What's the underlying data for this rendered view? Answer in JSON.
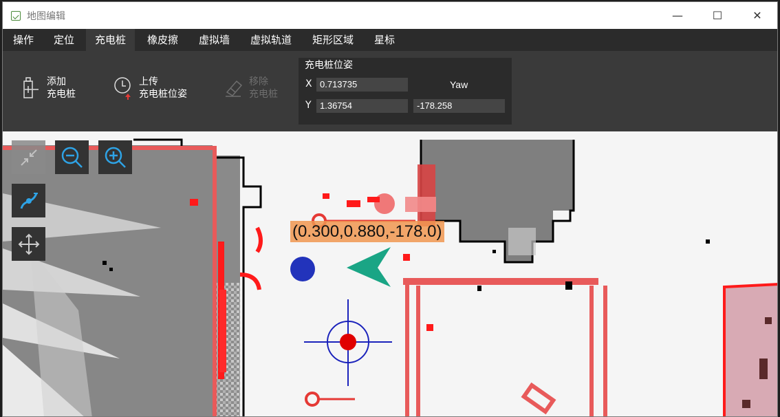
{
  "window": {
    "title": "地图编辑",
    "minimize": "—",
    "maximize": "☐",
    "close": "✕"
  },
  "menu": [
    {
      "label": "操作",
      "active": false
    },
    {
      "label": "定位",
      "active": false
    },
    {
      "label": "充电桩",
      "active": true
    },
    {
      "label": "橡皮擦",
      "active": false
    },
    {
      "label": "虚拟墙",
      "active": false
    },
    {
      "label": "虚拟轨道",
      "active": false
    },
    {
      "label": "矩形区域",
      "active": false
    },
    {
      "label": "星标",
      "active": false
    }
  ],
  "toolbar": {
    "add_line1": "添加",
    "add_line2": "充电桩",
    "upload_line1": "上传",
    "upload_line2": "充电桩位姿",
    "remove_line1": "移除",
    "remove_line2": "充电桩"
  },
  "pose": {
    "title": "充电桩位姿",
    "x_label": "X",
    "x_value": "0.713735",
    "y_label": "Y",
    "y_value": "1.36754",
    "yaw_label": "Yaw",
    "yaw_value": "-178.258"
  },
  "map": {
    "cursor_label": "(0.300,0.880,-178.0)",
    "tools": [
      "collapse-icon",
      "zoom-out-icon",
      "zoom-in-icon",
      "connect-icon",
      "move-icon"
    ],
    "colors": {
      "wall": "#e85a5a",
      "obstacle": "#808080",
      "charger_arrow": "#1aa585",
      "robot_dot": "#2233bb",
      "crosshair": "#1a22bb",
      "highlight": "#ff0000",
      "pink_zone": "#d8aab4"
    }
  }
}
